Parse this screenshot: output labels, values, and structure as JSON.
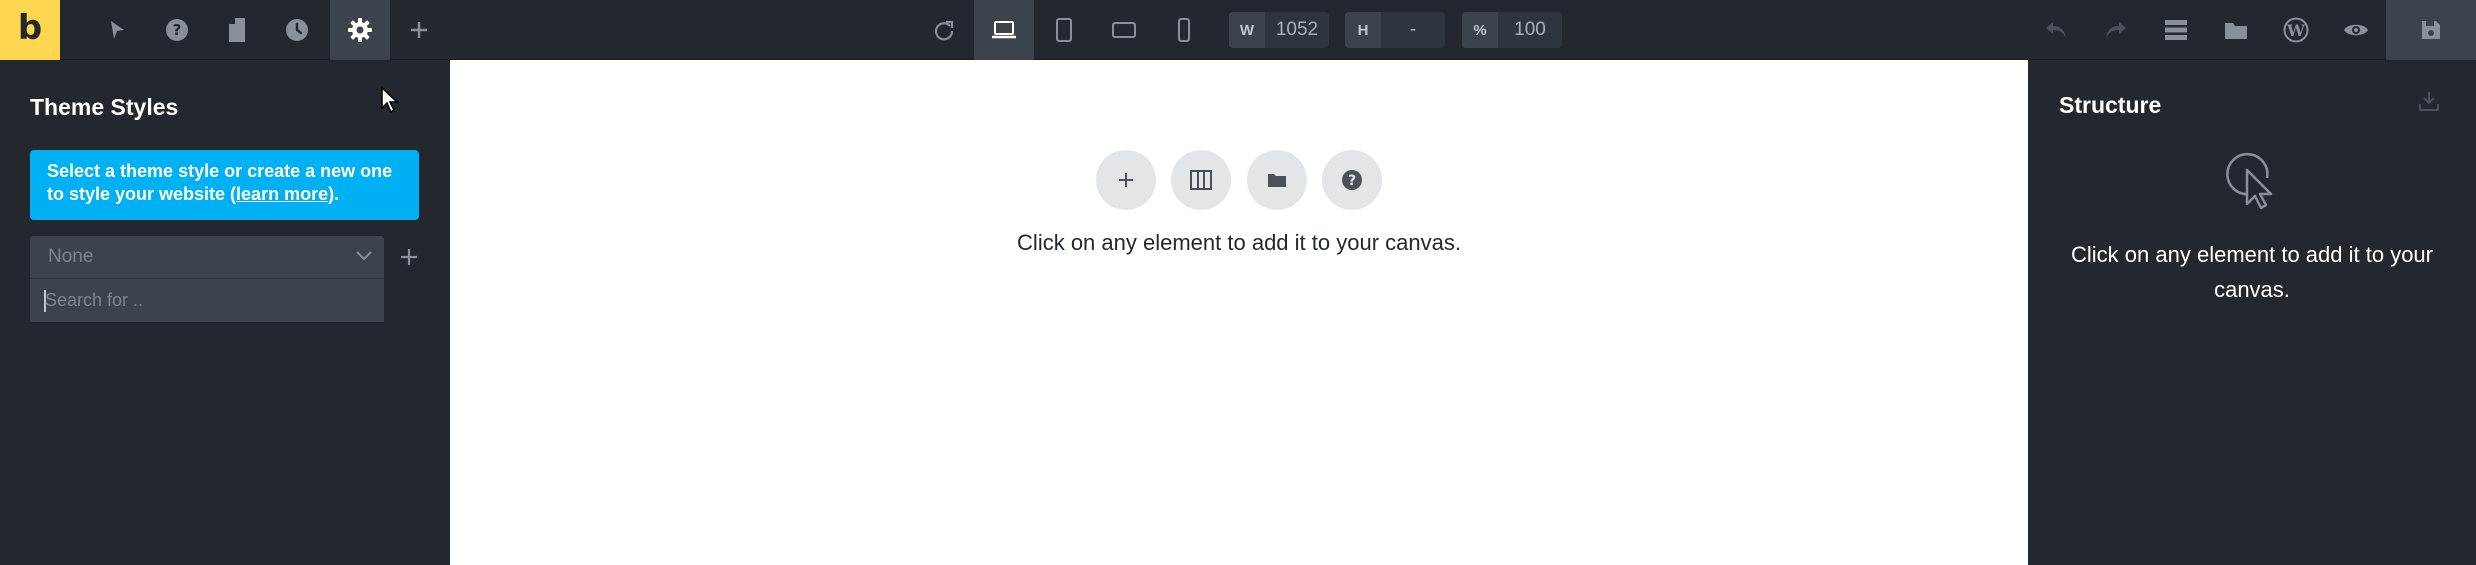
{
  "app": {
    "logo_letter": "b",
    "brand_color": "#ffd64f"
  },
  "toolbar": {
    "left_icons": [
      "select-icon",
      "help-icon",
      "pages-icon",
      "history-icon",
      "settings-icon",
      "add-icon"
    ],
    "active_icon": "settings-icon",
    "center_icons": [
      "refresh-icon",
      "desktop-icon",
      "tablet-portrait-icon",
      "tablet-landscape-icon",
      "mobile-icon"
    ],
    "active_device": "desktop-icon",
    "width_label": "W",
    "width_value": "1052",
    "height_label": "H",
    "height_value": "-",
    "zoom_label": "%",
    "zoom_value": "100",
    "right_icons": [
      "undo-icon",
      "redo-icon",
      "structure-icon",
      "templates-icon",
      "wordpress-icon",
      "preview-icon",
      "save-icon"
    ]
  },
  "left_panel": {
    "title": "Theme Styles",
    "info_text": "Select a theme style or create a new one to style your website (",
    "info_link": "learn more",
    "info_suffix": ").",
    "info_color": "#00b0f4",
    "select_value": "None",
    "search_placeholder": "Search for .."
  },
  "canvas": {
    "action_icons": [
      "add-element-icon",
      "columns-icon",
      "templates-folder-icon",
      "help-icon"
    ],
    "message": "Click on any element to add it to your canvas."
  },
  "right_panel": {
    "title": "Structure",
    "message": "Click on any element to add it to your canvas."
  }
}
